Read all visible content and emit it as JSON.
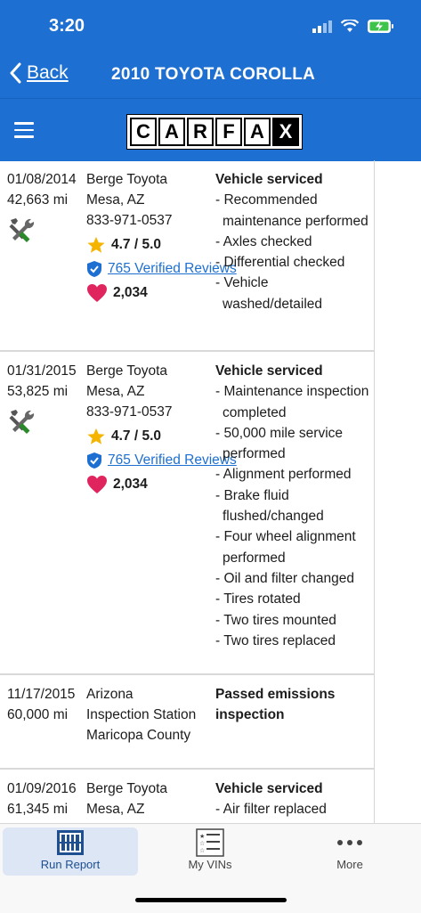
{
  "status_bar": {
    "time": "3:20"
  },
  "nav": {
    "back_label": "Back",
    "title": "2010 TOYOTA COROLLA"
  },
  "brand": {
    "logo_letters": [
      "C",
      "A",
      "R",
      "F",
      "A",
      "X"
    ]
  },
  "records": [
    {
      "date": "01/08/2014",
      "mileage": "42,663 mi",
      "source_name": "Berge Toyota",
      "source_location": "Mesa, AZ",
      "source_phone": "833-971-0537",
      "rating": "4.7 / 5.0",
      "reviews": "765 Verified Reviews",
      "favorites": "2,034",
      "headline": "Vehicle serviced",
      "details": [
        "- Recommended maintenance performed",
        "- Axles checked",
        "- Differential checked",
        "- Vehicle washed/detailed"
      ]
    },
    {
      "date": "01/31/2015",
      "mileage": "53,825 mi",
      "source_name": "Berge Toyota",
      "source_location": "Mesa, AZ",
      "source_phone": "833-971-0537",
      "rating": "4.7 / 5.0",
      "reviews": "765 Verified Reviews",
      "favorites": "2,034",
      "headline": "Vehicle serviced",
      "details": [
        "- Maintenance inspection completed",
        "- 50,000 mile service performed",
        "- Alignment performed",
        "- Brake fluid flushed/changed",
        "- Four wheel alignment performed",
        "- Oil and filter changed",
        "- Tires rotated",
        "- Two tires mounted",
        "- Two tires replaced"
      ]
    },
    {
      "date": "11/17/2015",
      "mileage": "60,000 mi",
      "source_name": "Arizona",
      "source_location": "Inspection Station",
      "source_phone": "Maricopa County",
      "headline": "Passed emissions inspection"
    },
    {
      "date": "01/09/2016",
      "mileage": "61,345 mi",
      "source_name": "Berge Toyota",
      "source_location": "Mesa, AZ",
      "headline": "Vehicle serviced",
      "details": [
        "- Air filter replaced"
      ]
    }
  ],
  "tabbar": {
    "tabs": [
      {
        "label": "Run Report"
      },
      {
        "label": "My VINs"
      },
      {
        "label": "More"
      }
    ]
  },
  "colors": {
    "brand_blue": "#1d6fd1",
    "star": "#f5b400",
    "heart": "#e0245e",
    "wrench_green": "#2a8a2a"
  }
}
